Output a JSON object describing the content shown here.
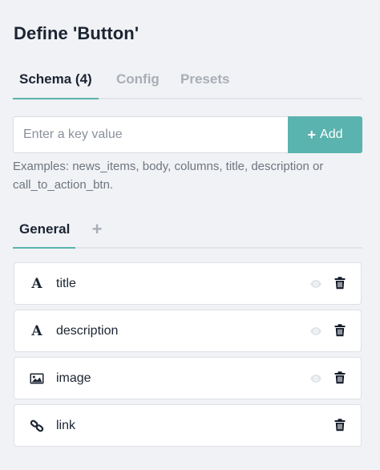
{
  "header": {
    "title": "Define 'Button'"
  },
  "tabs": [
    {
      "label": "Schema (4)",
      "active": true
    },
    {
      "label": "Config",
      "active": false
    },
    {
      "label": "Presets",
      "active": false
    }
  ],
  "key_input": {
    "placeholder": "Enter a key value",
    "value": "",
    "add_label": "Add",
    "add_icon": "plus-icon"
  },
  "hint": "Examples: news_items, body, columns, title, description or call_to_action_btn.",
  "subtabs": {
    "general_label": "General",
    "add_label": "+"
  },
  "fields": [
    {
      "label": "title",
      "type_icon": "text-type-icon",
      "type_glyph": "A",
      "visibility_icon": true
    },
    {
      "label": "description",
      "type_icon": "text-type-icon",
      "type_glyph": "A",
      "visibility_icon": true
    },
    {
      "label": "image",
      "type_icon": "image-icon",
      "visibility_icon": true
    },
    {
      "label": "link",
      "type_icon": "link-icon",
      "visibility_icon": false
    }
  ],
  "colors": {
    "accent": "#5ab3ae",
    "background": "#f0f2f5",
    "text": "#1c2433",
    "muted": "#a9aeb6"
  }
}
